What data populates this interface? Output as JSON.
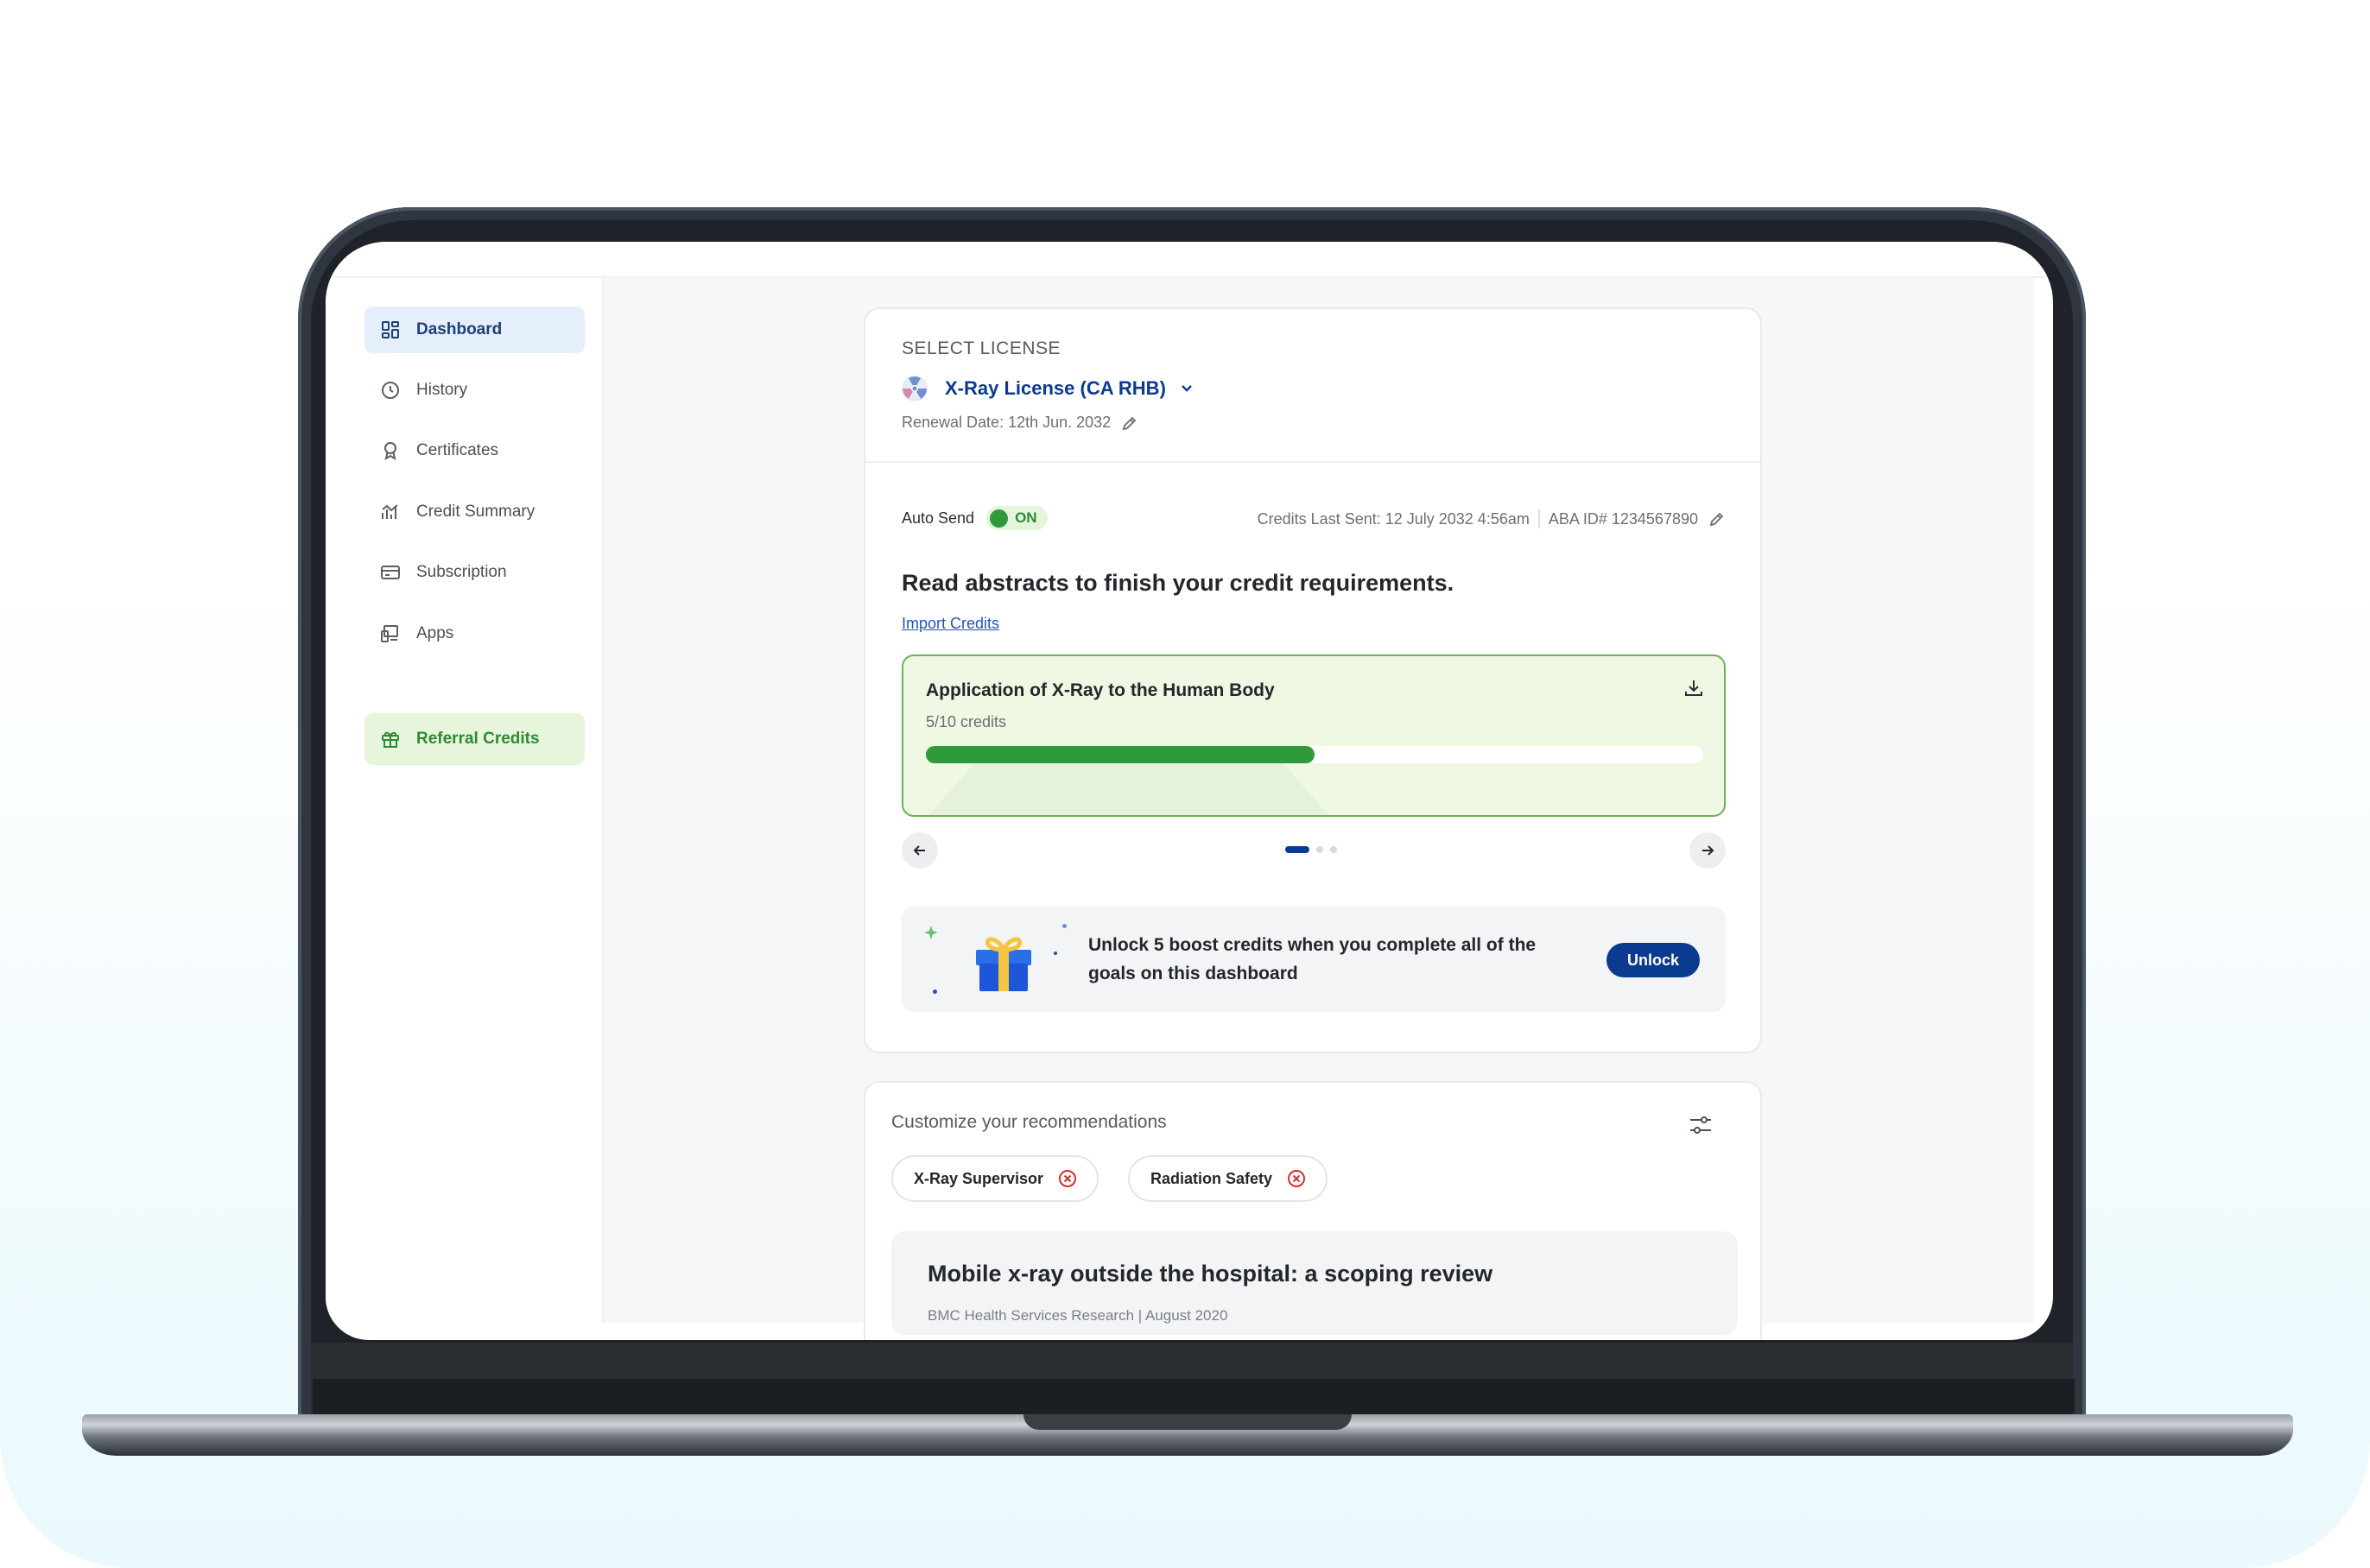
{
  "sidebar": {
    "items": [
      {
        "label": "Dashboard",
        "icon": "dashboard-icon",
        "active": true
      },
      {
        "label": "History",
        "icon": "history-icon"
      },
      {
        "label": "Certificates",
        "icon": "certificate-icon"
      },
      {
        "label": "Credit Summary",
        "icon": "chart-icon"
      },
      {
        "label": "Subscription",
        "icon": "card-icon"
      },
      {
        "label": "Apps",
        "icon": "devices-icon"
      }
    ],
    "referral": {
      "label": "Referral Credits",
      "icon": "gift-icon"
    }
  },
  "license": {
    "section_label": "SELECT LICENSE",
    "name": "X-Ray License (CA RHB)",
    "renewal": "Renewal Date: 12th Jun. 2032"
  },
  "status": {
    "auto_send_label": "Auto Send",
    "toggle_state": "ON",
    "last_sent": "Credits Last Sent: 12 July 2032 4:56am",
    "aba_id": "ABA ID# 1234567890"
  },
  "goal": {
    "heading": "Read abstracts to finish your credit requirements.",
    "import_link": "Import Credits"
  },
  "course": {
    "title": "Application of X-Ray to the Human Body",
    "credits_text": "5/10 credits",
    "progress_fraction": 0.5
  },
  "carousel": {
    "page": 1,
    "total": 3
  },
  "promo": {
    "text": "Unlock 5 boost credits when you complete all of the goals on this dashboard",
    "button": "Unlock"
  },
  "recommendations": {
    "title": "Customize your recommendations",
    "chips": [
      "X-Ray Supervisor",
      "Radiation Safety"
    ],
    "article": {
      "title": "Mobile x-ray outside the hospital: a scoping review",
      "source": "BMC Health Services Research | August 2020"
    }
  },
  "colors": {
    "brand_blue": "#0b3b8f",
    "success_green": "#2e9a3a",
    "referral_green": "#2e8b33",
    "remove_red": "#d62d2d"
  }
}
